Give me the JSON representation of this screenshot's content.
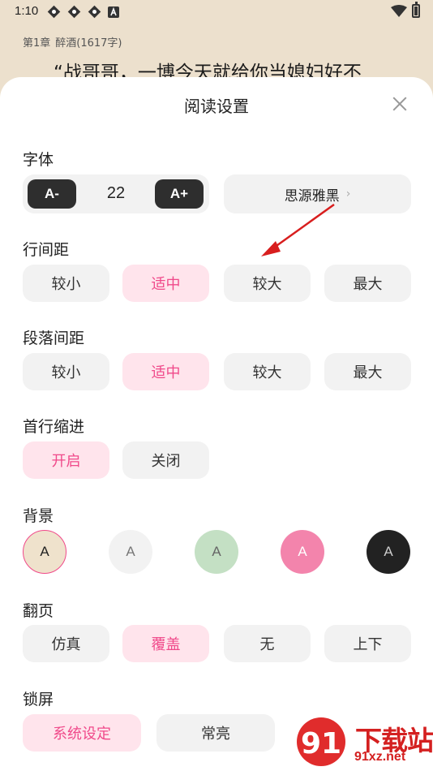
{
  "status_bar": {
    "time": "1:10",
    "notification_icons": [
      "notification-icon",
      "notification-icon",
      "notification-icon",
      "a-box-icon"
    ],
    "wifi_icon": "wifi-icon",
    "battery_icon": "battery-icon"
  },
  "reader": {
    "chapter": "第1章",
    "chapter_title": "醉酒(1617字)",
    "text": "“战哥哥，一博今天就给你当媳妇好不"
  },
  "sheet": {
    "title": "阅读设置",
    "close_icon": "close-icon",
    "font": {
      "label": "字体",
      "decrease": "A-",
      "size": "22",
      "increase": "A+",
      "family": "思源雅黑",
      "chevron": "›"
    },
    "line_spacing": {
      "label": "行间距",
      "options": [
        "较小",
        "适中",
        "较大",
        "最大"
      ],
      "selected": 1
    },
    "paragraph_spacing": {
      "label": "段落间距",
      "options": [
        "较小",
        "适中",
        "较大",
        "最大"
      ],
      "selected": 1
    },
    "indent": {
      "label": "首行缩进",
      "options": [
        "开启",
        "关闭"
      ],
      "selected": 0
    },
    "background": {
      "label": "背景",
      "swatches": [
        {
          "letter": "A",
          "bg": "#efe2cc",
          "fg": "#222222",
          "selected": true
        },
        {
          "letter": "A",
          "bg": "#f2f2f2",
          "fg": "#777777",
          "selected": false
        },
        {
          "letter": "A",
          "bg": "#c4e0c4",
          "fg": "#666666",
          "selected": false
        },
        {
          "letter": "A",
          "bg": "#f384ac",
          "fg": "#ffffff",
          "selected": false
        },
        {
          "letter": "A",
          "bg": "#222222",
          "fg": "#cccccc",
          "selected": false
        }
      ]
    },
    "page_turn": {
      "label": "翻页",
      "options": [
        "仿真",
        "覆盖",
        "无",
        "上下"
      ],
      "selected": 1
    },
    "lock_screen": {
      "label": "锁屏",
      "options": [
        "系统设定",
        "常亮"
      ],
      "selected": 0
    }
  },
  "watermark": {
    "text": "下载站",
    "url": "91xz.net"
  },
  "colors": {
    "accent": "#f0498a",
    "accent_bg": "#ffe4ec",
    "option_bg": "#f2f2f2",
    "page_bg": "#ece0cd",
    "annotation_arrow": "#d81e1e"
  }
}
